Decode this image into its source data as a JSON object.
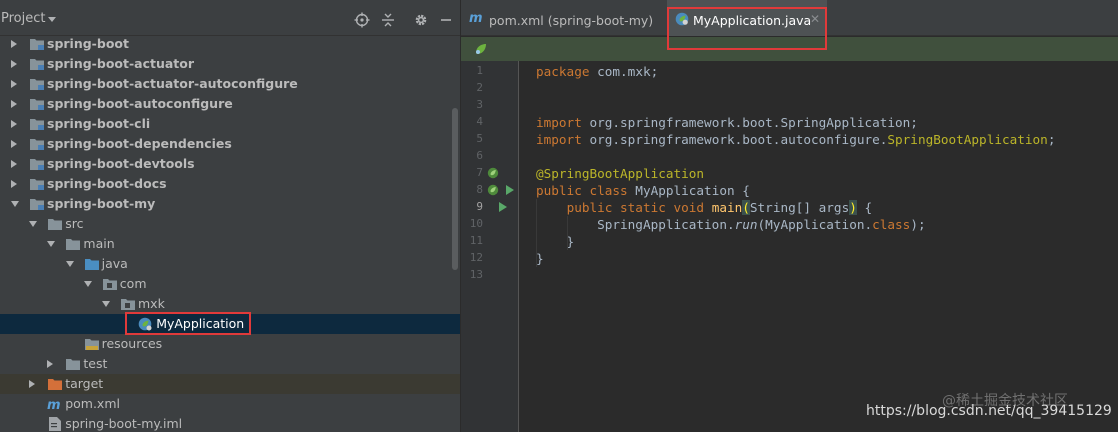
{
  "project_panel": {
    "title": "Project",
    "tree": [
      {
        "label": "spring-boot",
        "depth": 0,
        "state": "closed",
        "icon": "module-folder-icon",
        "bold": true
      },
      {
        "label": "spring-boot-actuator",
        "depth": 0,
        "state": "closed",
        "icon": "module-folder-icon",
        "bold": true
      },
      {
        "label": "spring-boot-actuator-autoconfigure",
        "depth": 0,
        "state": "closed",
        "icon": "module-folder-icon",
        "bold": true
      },
      {
        "label": "spring-boot-autoconfigure",
        "depth": 0,
        "state": "closed",
        "icon": "module-folder-icon",
        "bold": true
      },
      {
        "label": "spring-boot-cli",
        "depth": 0,
        "state": "closed",
        "icon": "module-folder-icon",
        "bold": true
      },
      {
        "label": "spring-boot-dependencies",
        "depth": 0,
        "state": "closed",
        "icon": "module-folder-icon",
        "bold": true
      },
      {
        "label": "spring-boot-devtools",
        "depth": 0,
        "state": "closed",
        "icon": "module-folder-icon",
        "bold": true
      },
      {
        "label": "spring-boot-docs",
        "depth": 0,
        "state": "closed",
        "icon": "module-folder-icon",
        "bold": true
      },
      {
        "label": "spring-boot-my",
        "depth": 0,
        "state": "open",
        "icon": "module-folder-icon",
        "bold": true
      },
      {
        "label": "src",
        "depth": 1,
        "state": "open",
        "icon": "folder-icon",
        "bold": false
      },
      {
        "label": "main",
        "depth": 2,
        "state": "open",
        "icon": "folder-icon",
        "bold": false
      },
      {
        "label": "java",
        "depth": 3,
        "state": "open",
        "icon": "source-folder-icon",
        "bold": false
      },
      {
        "label": "com",
        "depth": 4,
        "state": "open",
        "icon": "package-icon",
        "bold": false
      },
      {
        "label": "mxk",
        "depth": 5,
        "state": "open",
        "icon": "package-icon",
        "bold": false
      },
      {
        "label": "MyApplication",
        "depth": 6,
        "state": "none",
        "icon": "spring-boot-class-icon",
        "bold": false,
        "selected": true
      },
      {
        "label": "resources",
        "depth": 3,
        "state": "none",
        "icon": "resources-folder-icon",
        "bold": false
      },
      {
        "label": "test",
        "depth": 2,
        "state": "closed",
        "icon": "folder-icon",
        "bold": false
      },
      {
        "label": "target",
        "depth": 1,
        "state": "closed",
        "icon": "excluded-folder-icon",
        "bold": false,
        "excluded": true
      },
      {
        "label": "pom.xml",
        "depth": 1,
        "state": "none",
        "icon": "maven-icon",
        "bold": false
      },
      {
        "label": "spring-boot-my.iml",
        "depth": 1,
        "state": "none",
        "icon": "iml-file-icon",
        "bold": false
      }
    ]
  },
  "editor": {
    "tabs": [
      {
        "label": "pom.xml (spring-boot-my)",
        "icon": "maven-icon",
        "active": false
      },
      {
        "label": "MyApplication.java",
        "icon": "spring-boot-class-icon",
        "active": true
      }
    ],
    "line_numbers": [
      "1",
      "2",
      "3",
      "4",
      "5",
      "6",
      "7",
      "8",
      "9",
      "10",
      "11",
      "12",
      "13"
    ],
    "current_line": "9",
    "code": {
      "l1_kw": "package",
      "l1_rest": " com.mxk;",
      "l4_kw": "import",
      "l4_rest": " org.springframework.boot.SpringApplication;",
      "l5_kw": "import",
      "l5_rest": " org.springframework.boot.autoconfigure.",
      "l5_ann": "SpringBootApplication",
      "l5_end": ";",
      "l7_ann": "@SpringBootApplication",
      "l8_kw": "public class",
      "l8_rest": " MyApplication {",
      "l9_indent": "    ",
      "l9_kw": "public static void",
      "l9_sp": " ",
      "l9_fn": "main",
      "l9_paren_open": "(",
      "l9_args": "String[] args",
      "l9_paren_close": ")",
      "l9_end": " {",
      "l10_indent": "        ",
      "l10_a": "SpringApplication.",
      "l10_run": "run",
      "l10_b": "(MyApplication.",
      "l10_kw": "class",
      "l10_c": ");",
      "l11": "    }",
      "l12": "}"
    }
  },
  "watermark": {
    "text": "https://blog.csdn.net/qq_39415129",
    "text2": "@稀土掘金技术社区"
  },
  "colors": {
    "panel_bg": "#3c3f41",
    "editor_bg": "#2b2b2b",
    "keyword": "#cc7832",
    "annotation": "#bbb529",
    "method": "#ffc66d",
    "text": "#a9b7c6",
    "selection": "#0d293e",
    "highlight_box": "#e03a3a",
    "run_icon": "#59a869"
  }
}
